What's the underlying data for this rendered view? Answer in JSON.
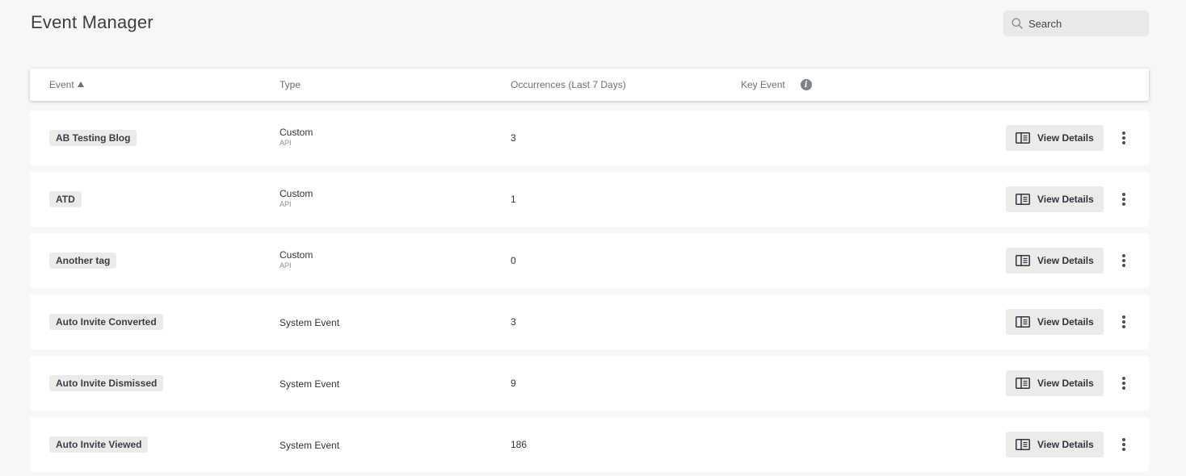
{
  "page": {
    "title": "Event Manager"
  },
  "search": {
    "placeholder": "Search"
  },
  "table": {
    "columns": {
      "event": "Event",
      "type": "Type",
      "occurrences": "Occurrences (Last 7 Days)",
      "key_event": "Key Event"
    },
    "sort": {
      "column": "Event",
      "direction": "ascending"
    },
    "rows": [
      {
        "event": "AB Testing Blog",
        "type": "Custom",
        "source": "API",
        "occurrences": "3"
      },
      {
        "event": "ATD",
        "type": "Custom",
        "source": "API",
        "occurrences": "1"
      },
      {
        "event": "Another tag",
        "type": "Custom",
        "source": "API",
        "occurrences": "0"
      },
      {
        "event": "Auto Invite Converted",
        "type": "System Event",
        "source": "",
        "occurrences": "3"
      },
      {
        "event": "Auto Invite Dismissed",
        "type": "System Event",
        "source": "",
        "occurrences": "9"
      },
      {
        "event": "Auto Invite Viewed",
        "type": "System Event",
        "source": "",
        "occurrences": "186"
      }
    ],
    "row_action_label": "View Details"
  },
  "icons": {
    "search": "search-icon",
    "sort": "sort-ascending-icon",
    "info": "info-icon",
    "details": "details-panel-icon",
    "more": "more-vertical-icon"
  },
  "colors": {
    "background": "#f7f7f6",
    "row_background": "#ffffff",
    "tag_background": "#ebebea",
    "text": "#2f3640"
  }
}
